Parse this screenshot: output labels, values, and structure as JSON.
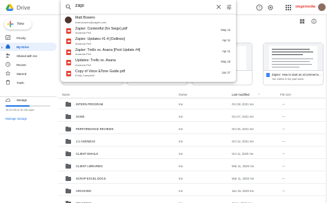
{
  "app": {
    "title": "Drive",
    "brand": "siegemedia"
  },
  "search": {
    "query": "zapi",
    "suggestions": [
      {
        "title": "Matt Bowers",
        "subtitle": "matt.bowers@zapier.com",
        "date": "",
        "type": "person"
      },
      {
        "title": "Zapier: Contentful (for Siege).pdf",
        "subtitle": "Amanda Pell",
        "date": "May 12",
        "type": "pdf"
      },
      {
        "title": "Zapier: Updates #1-4 [Outlines]",
        "subtitle": "Amanda Pell",
        "date": "Apr 11",
        "type": "pdf"
      },
      {
        "title": "Zapier: Trello vs. Asana [Post Update #4]",
        "subtitle": "Amanda Pell",
        "date": "Apr 11",
        "type": "pdf"
      },
      {
        "title": "Updates: Trello vs. Asana",
        "subtitle": "Amanda Pell",
        "date": "May 18",
        "type": "pdf"
      },
      {
        "title": "Copy of Voice &Tone Guide.pdf",
        "subtitle": "Emily Campbell",
        "date": "Jan 27",
        "type": "pdf"
      }
    ]
  },
  "sidebar": {
    "new_label": "New",
    "items": [
      {
        "label": "Priority",
        "icon": "checkbox-icon",
        "active": false
      },
      {
        "label": "My Drive",
        "icon": "drive-icon",
        "active": true
      },
      {
        "label": "Shared with me",
        "icon": "people-icon",
        "active": false
      },
      {
        "label": "Recent",
        "icon": "clock-icon",
        "active": false
      },
      {
        "label": "Starred",
        "icon": "star-icon",
        "active": false
      },
      {
        "label": "Trash",
        "icon": "trash-icon",
        "active": false
      }
    ],
    "storage": {
      "label": "Storage",
      "used_text": "16.23 GB of 30 GB used",
      "used_fraction": 0.54,
      "manage_label": "Manage storage"
    }
  },
  "quick_access": [
    {
      "title": "Zapier: How to start an eCommerce...",
      "subtitle": "You edited in the past week"
    }
  ],
  "file_list": {
    "columns": {
      "name": "Name",
      "owner": "Owner",
      "modified": "Last modified",
      "size": "File size"
    },
    "rows": [
      {
        "name": "INTERN PROGRAM",
        "owner": "me",
        "modified": "Oct 28, 2021 me",
        "size": "—"
      },
      {
        "name": "SCMS",
        "owner": "me",
        "modified": "Oct 27, 2021 me",
        "size": "—"
      },
      {
        "name": "PERFORMANCE REVIEWS",
        "owner": "me",
        "modified": "Oct 25, 2021 me",
        "size": "—"
      },
      {
        "name": "1:1 AGENDAS",
        "owner": "me",
        "modified": "Oct 12, 2021 me",
        "size": "—"
      },
      {
        "name": "CLIENT EMAILS",
        "owner": "me",
        "modified": "Oct 11, 2020 me",
        "size": "—"
      },
      {
        "name": "CLIENT LIBRARIES",
        "owner": "me",
        "modified": "Mar 11, 2020 me",
        "size": "—"
      },
      {
        "name": "SCRAP EXCEL DOCS",
        "owner": "me",
        "modified": "Mar 11, 2020 me",
        "size": "—"
      },
      {
        "name": "ARCHIVED",
        "owner": "me",
        "modified": "Jan 15, 2020 me",
        "size": "—"
      },
      {
        "name": "BRANDING",
        "owner": "me",
        "modified": "Oct 1, 2019 me",
        "size": "—"
      }
    ]
  },
  "colors": {
    "accent": "#1a73e8",
    "active_bg": "#e8f0fe",
    "brand": "#e8453c"
  }
}
